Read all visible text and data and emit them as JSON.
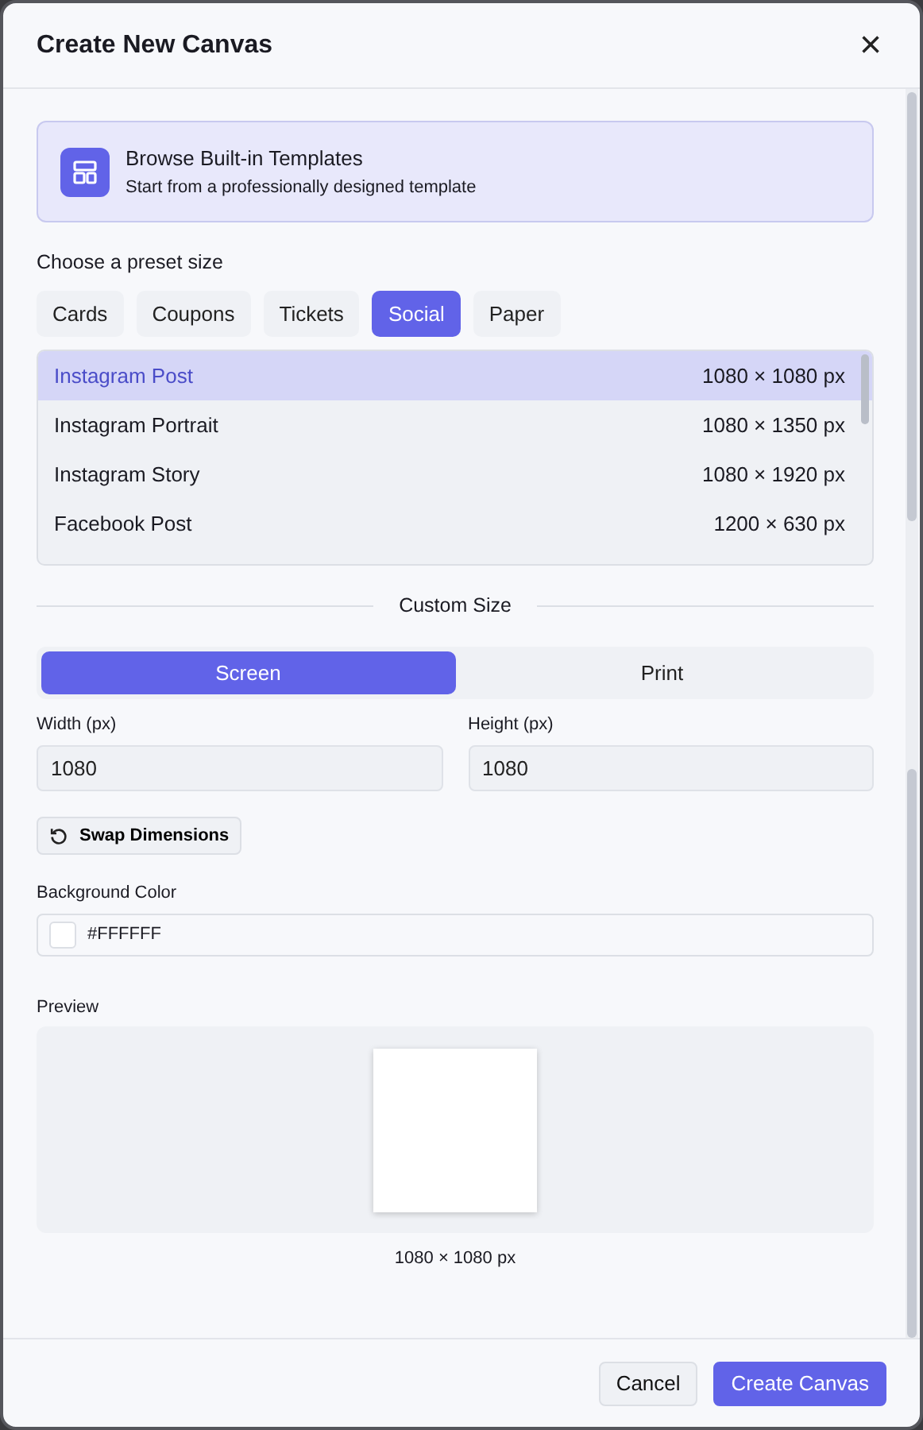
{
  "dialog": {
    "title": "Create New Canvas",
    "close": "×"
  },
  "templates_banner": {
    "title": "Browse Built-in Templates",
    "subtitle": "Start from a professionally designed template"
  },
  "preset_label": "Choose a preset size",
  "categories": [
    {
      "label": "Cards",
      "selected": false
    },
    {
      "label": "Coupons",
      "selected": false
    },
    {
      "label": "Tickets",
      "selected": false
    },
    {
      "label": "Social",
      "selected": true
    },
    {
      "label": "Paper",
      "selected": false
    }
  ],
  "presets": [
    {
      "name": "Instagram Post",
      "size": "1080 × 1080 px",
      "selected": true
    },
    {
      "name": "Instagram Portrait",
      "size": "1080 × 1350 px",
      "selected": false
    },
    {
      "name": "Instagram Story",
      "size": "1080 × 1920 px",
      "selected": false
    },
    {
      "name": "Facebook Post",
      "size": "1200 × 630 px",
      "selected": false
    }
  ],
  "custom_size_label": "Custom Size",
  "modes": [
    {
      "label": "Screen",
      "selected": true
    },
    {
      "label": "Print",
      "selected": false
    }
  ],
  "width": {
    "label": "Width (px)",
    "value": "1080"
  },
  "height": {
    "label": "Height (px)",
    "value": "1080"
  },
  "swap_button": "Swap Dimensions",
  "background": {
    "label": "Background Color",
    "value": "#FFFFFF",
    "color": "#ffffff"
  },
  "preview": {
    "label": "Preview",
    "caption": "1080 × 1080 px"
  },
  "buttons": [
    {
      "label": "Cancel",
      "kind": "secondary"
    },
    {
      "label": "Create Canvas",
      "kind": "primary"
    }
  ]
}
